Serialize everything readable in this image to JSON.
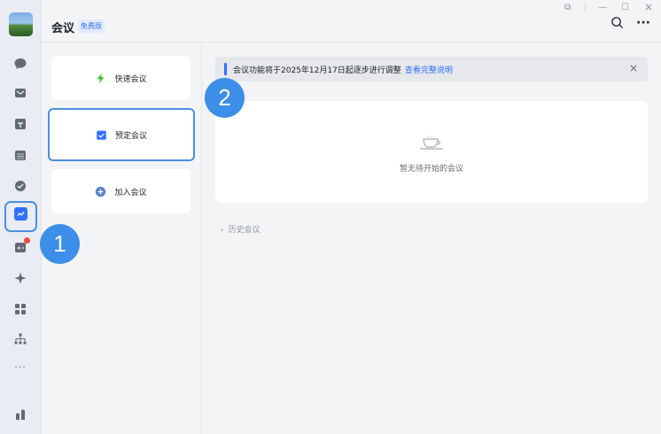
{
  "app": {
    "title": "会议",
    "badge": "免费版"
  },
  "meeting_options": [
    {
      "label": "快速会议",
      "icon": "lightning-icon"
    },
    {
      "label": "预定会议",
      "icon": "calendar-check-icon"
    },
    {
      "label": "加入会议",
      "icon": "plus-circle-icon"
    }
  ],
  "notice": {
    "text": "会议功能将于2025年12月17日起逐步进行调整",
    "link": "查看完整说明",
    "close": "×"
  },
  "empty_state": {
    "text": "暂无待开始的会议"
  },
  "history": {
    "chevron": "›",
    "label": "历史会议"
  },
  "window_controls": {
    "pin": "⧉",
    "sep": "|",
    "minimize": "—",
    "maximize": "☐",
    "close": "×"
  },
  "header_icons": {
    "search": "○",
    "more": "···"
  },
  "callouts": {
    "one": "1",
    "two": "2"
  },
  "rail_more": "···",
  "colors": {
    "accent": "#3370ff",
    "callout": "#3d8ee8",
    "highlight_border": "#4b8fe0",
    "lightning": "#34c724"
  }
}
